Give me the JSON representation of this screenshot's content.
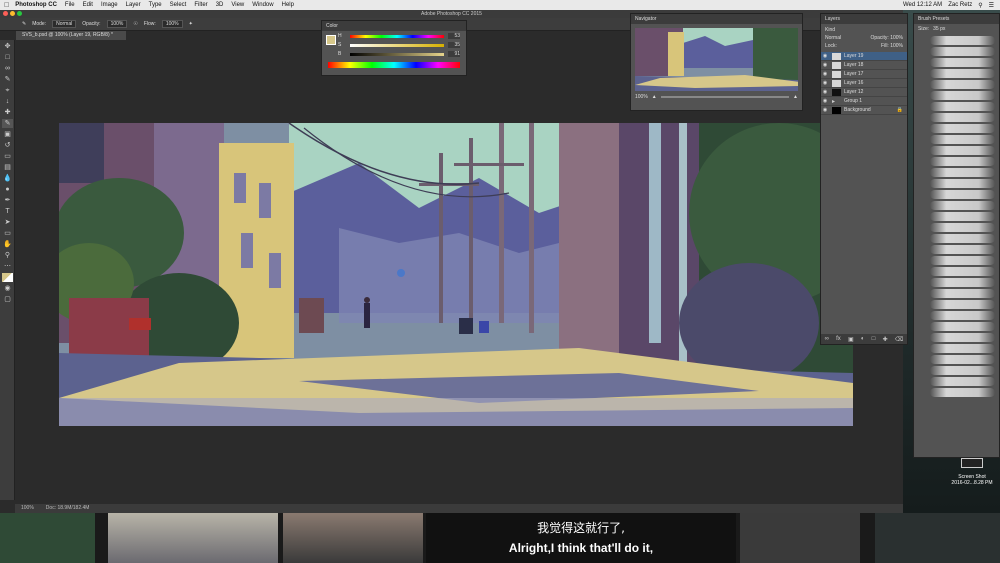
{
  "menubar": {
    "app_name": "Photoshop CC",
    "items": [
      "File",
      "Edit",
      "Image",
      "Layer",
      "Type",
      "Select",
      "Filter",
      "3D",
      "View",
      "Window",
      "Help"
    ],
    "clock": "Wed 12:12 AM",
    "user": "Zac Retz"
  },
  "window": {
    "title": "Adobe Photoshop CC 2015"
  },
  "options": {
    "mode_label": "Mode:",
    "mode_value": "Normal",
    "opacity_label": "Opacity:",
    "opacity_value": "100%",
    "flow_label": "Flow:",
    "flow_value": "100%"
  },
  "document": {
    "tab_title": "SVS_b.psd @ 100% (Layer 19, RGB/8) *",
    "status_zoom": "100%",
    "status_doc": "Doc: 18.9M/182.4M"
  },
  "color_panel": {
    "title": "Color",
    "rows": [
      {
        "label": "H",
        "value": "53"
      },
      {
        "label": "S",
        "value": "35"
      },
      {
        "label": "B",
        "value": "91"
      }
    ]
  },
  "navigator": {
    "title": "Navigator",
    "zoom": "100%"
  },
  "layers": {
    "title": "Layers",
    "kind_label": "Kind",
    "blend": "Normal",
    "opacity": "Opacity: 100%",
    "lock_label": "Lock:",
    "fill": "Fill: 100%",
    "items": [
      {
        "name": "Layer 19",
        "active": true
      },
      {
        "name": "Layer 18",
        "active": false
      },
      {
        "name": "Layer 17",
        "active": false
      },
      {
        "name": "Layer 16",
        "active": false
      },
      {
        "name": "Layer 12",
        "active": false
      },
      {
        "name": "Group 1",
        "active": false
      },
      {
        "name": "Background",
        "active": false
      }
    ]
  },
  "brush_presets": {
    "title": "Brush Presets",
    "size_label": "Size:",
    "size_value": "35 px"
  },
  "desktop_icon": {
    "label": "Screen Shot",
    "sublabel": "2016-02...8.28 PM"
  },
  "subtitles": {
    "cn": "我觉得这就行了,",
    "en": "Alright,I think that'll do it,"
  },
  "colors": {
    "sky": "#a9d3c2",
    "mountain": "#5b5f9c",
    "street_light": "#d6c78a",
    "street_shadow": "#5c628f",
    "foliage": "#3a5a3e",
    "building_left": "#6a4f6a",
    "accent_red": "#b0302c"
  }
}
